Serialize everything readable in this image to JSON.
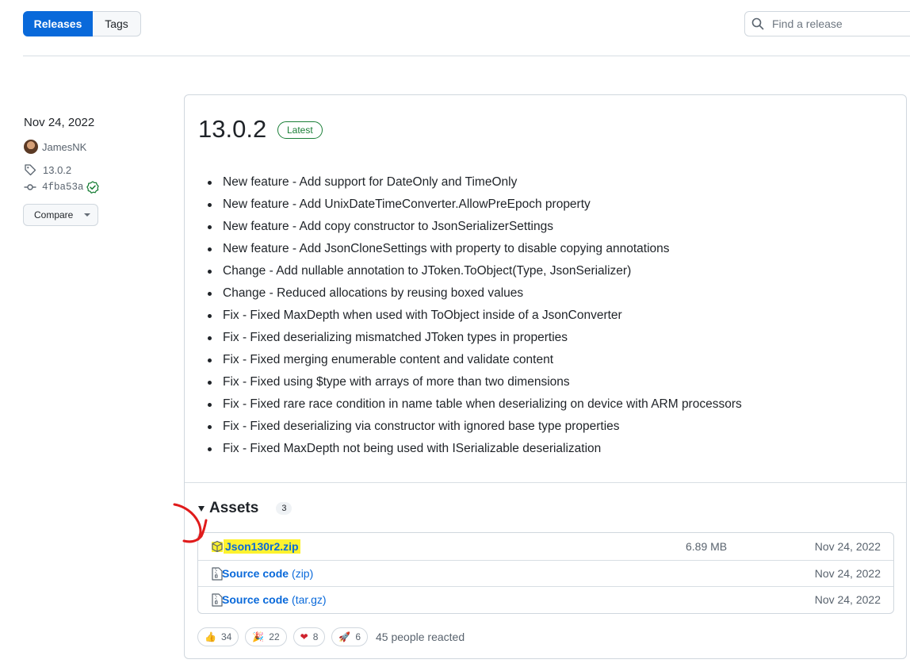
{
  "tabs": {
    "releases": "Releases",
    "tags": "Tags"
  },
  "search": {
    "placeholder": "Find a release"
  },
  "sidebar": {
    "date": "Nov 24, 2022",
    "author": "JamesNK",
    "tag": "13.0.2",
    "commit": "4fba53a",
    "compare_label": "Compare"
  },
  "release": {
    "version": "13.0.2",
    "badge": "Latest",
    "notes": [
      "New feature - Add support for DateOnly and TimeOnly",
      "New feature - Add UnixDateTimeConverter.AllowPreEpoch property",
      "New feature - Add copy constructor to JsonSerializerSettings",
      "New feature - Add JsonCloneSettings with property to disable copying annotations",
      "Change - Add nullable annotation to JToken.ToObject(Type, JsonSerializer)",
      "Change - Reduced allocations by reusing boxed values",
      "Fix - Fixed MaxDepth when used with ToObject inside of a JsonConverter",
      "Fix - Fixed deserializing mismatched JToken types in properties",
      "Fix - Fixed merging enumerable content and validate content",
      "Fix - Fixed using $type with arrays of more than two dimensions",
      "Fix - Fixed rare race condition in name table when deserializing on device with ARM processors",
      "Fix - Fixed deserializing via constructor with ignored base type properties",
      "Fix - Fixed MaxDepth not being used with ISerializable deserialization"
    ]
  },
  "assets": {
    "title": "Assets",
    "count": "3",
    "items": [
      {
        "name": "Json130r2.zip",
        "sub": "",
        "size": "6.89 MB",
        "date": "Nov 24, 2022"
      },
      {
        "name": "Source code",
        "sub": "(zip)",
        "size": "",
        "date": "Nov 24, 2022"
      },
      {
        "name": "Source code",
        "sub": "(tar.gz)",
        "size": "",
        "date": "Nov 24, 2022"
      }
    ]
  },
  "reactions": {
    "items": [
      {
        "icon": "thumbs-up-icon",
        "emoji": "👍",
        "count": "34"
      },
      {
        "icon": "party-popper-icon",
        "emoji": "🎉",
        "count": "22"
      },
      {
        "icon": "heart-icon",
        "emoji": "❤",
        "count": "8"
      },
      {
        "icon": "rocket-icon",
        "emoji": "🚀",
        "count": "6"
      }
    ],
    "summary": "45 people reacted"
  },
  "colors": {
    "accent": "#0969da",
    "success": "#1a7f37",
    "highlight": "#fdf22f",
    "annotation": "#e01b1b"
  }
}
